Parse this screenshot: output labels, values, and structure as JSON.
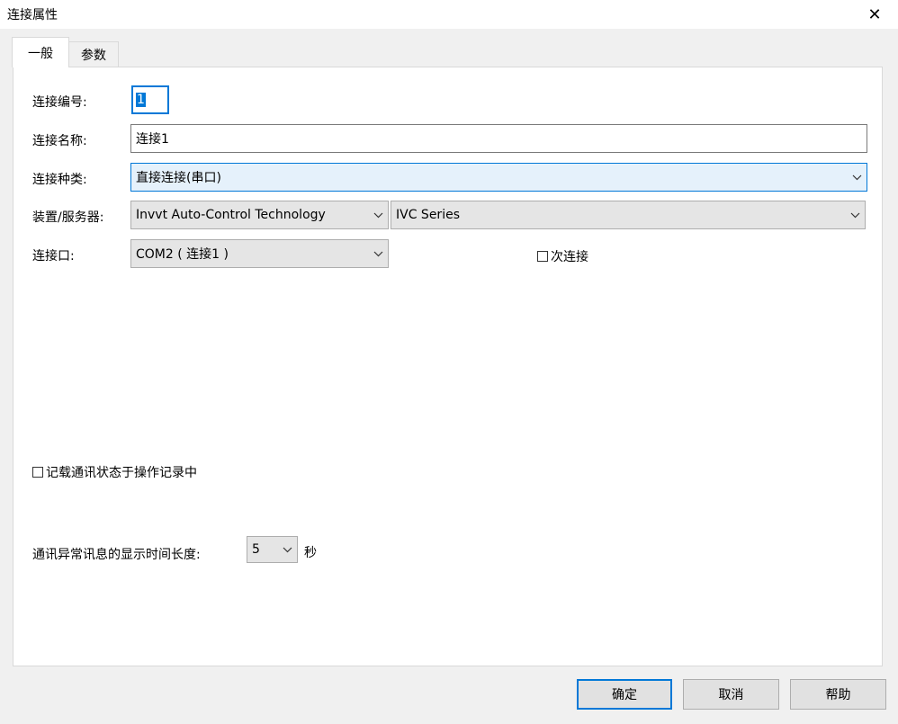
{
  "window": {
    "title": "连接属性"
  },
  "tabs": [
    {
      "label": "一般"
    },
    {
      "label": "参数"
    }
  ],
  "form": {
    "id": {
      "label": "连接编号:",
      "value": "1"
    },
    "name": {
      "label": "连接名称:",
      "value": "连接1"
    },
    "type": {
      "label": "连接种类:",
      "value": "直接连接(串口)"
    },
    "device": {
      "label": "装置/服务器:",
      "vendor": "Invvt Auto-Control Technology",
      "series": "IVC Series"
    },
    "port": {
      "label": "连接口:",
      "value": "COM2 ( 连接1 )"
    },
    "secondary": {
      "label": "次连接",
      "checked": false
    },
    "log_comm": {
      "label": "记载通讯状态于操作记录中",
      "checked": false
    },
    "timeout": {
      "label": "通讯异常讯息的显示时间长度:",
      "value": "5",
      "unit": "秒"
    }
  },
  "buttons": {
    "ok": "确定",
    "cancel": "取消",
    "help": "帮助"
  }
}
